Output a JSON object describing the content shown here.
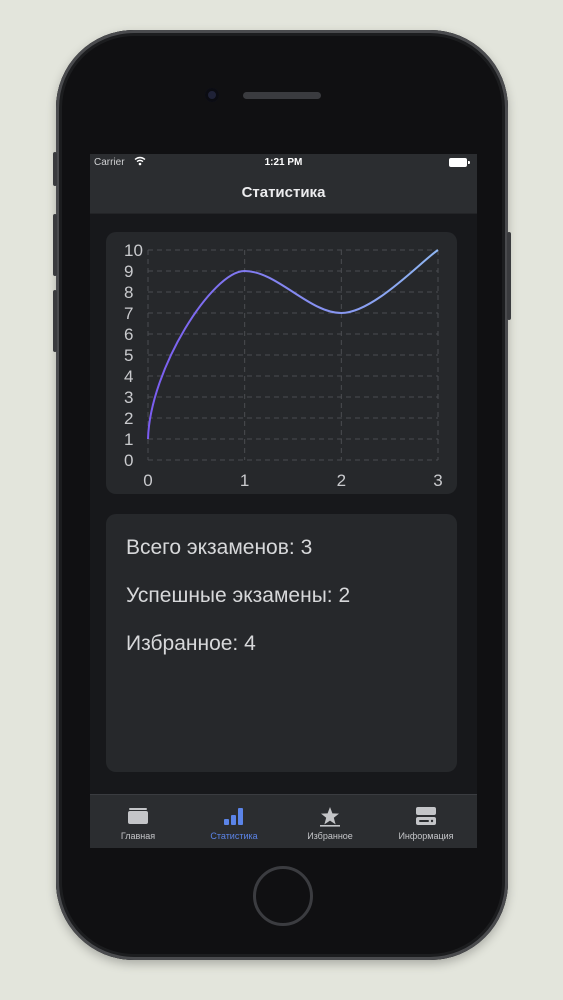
{
  "status_bar": {
    "carrier": "Carrier",
    "time": "1:21 PM"
  },
  "nav": {
    "title": "Статистика"
  },
  "chart_data": {
    "type": "line",
    "x": [
      0,
      1,
      2,
      3
    ],
    "y": [
      1,
      9,
      7,
      10
    ],
    "xlim": [
      0,
      3
    ],
    "ylim": [
      0,
      10
    ],
    "x_ticks": [
      "0",
      "1",
      "2",
      "3"
    ],
    "y_ticks": [
      "0",
      "1",
      "2",
      "3",
      "4",
      "5",
      "6",
      "7",
      "8",
      "9",
      "10"
    ],
    "grid": true,
    "grid_style": "dashed",
    "line_gradient": [
      "#7a5cf0",
      "#8fb6f2"
    ],
    "title": "",
    "xlabel": "",
    "ylabel": ""
  },
  "stats": {
    "total_exams": "Всего экзаменов: 3",
    "passed_exams": "Успешные экзамены: 2",
    "favorites": "Избранное: 4"
  },
  "tabs": [
    {
      "label": "Главная",
      "icon": "cards-icon",
      "active": false
    },
    {
      "label": "Статистика",
      "icon": "bar-chart-icon",
      "active": true
    },
    {
      "label": "Избранное",
      "icon": "star-icon",
      "active": false
    },
    {
      "label": "Информация",
      "icon": "info-box-icon",
      "active": false
    }
  ],
  "colors": {
    "accent": "#5b84e8",
    "background": "#17181b",
    "card": "#26282b",
    "bar": "#2b2d30"
  }
}
